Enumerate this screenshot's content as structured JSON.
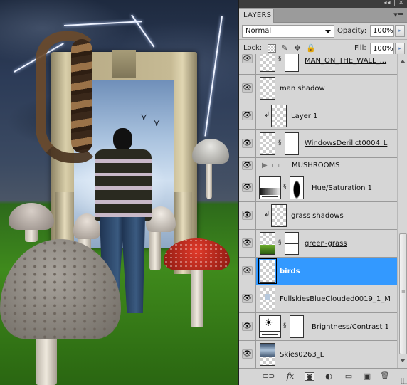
{
  "canvas": {
    "description": "Photo-manipulation artwork: man standing before stone doorway with blue sky, snake on frame, lightning, mushrooms on green grass",
    "icon": "artwork-image"
  },
  "panel": {
    "title_controls": "◂◂ | ✕",
    "tab_label": "LAYERS",
    "menu_icon": "panel-menu-icon",
    "blend_mode": "Normal",
    "opacity_label": "Opacity:",
    "opacity_value": "100%",
    "lock_label": "Lock:",
    "fill_label": "Fill:",
    "fill_value": "100%",
    "arrow_glyph": "▸"
  },
  "layers": [
    {
      "name": "MAN_ON_THE_WALL_...",
      "visible": true,
      "underlined": true,
      "type": "smart-with-mask"
    },
    {
      "name": "man shadow",
      "visible": true,
      "underlined": false,
      "type": "pixel"
    },
    {
      "name": "Layer 1",
      "visible": true,
      "underlined": false,
      "type": "clipped-pixel"
    },
    {
      "name": "WindowsDerilict0004_L",
      "visible": true,
      "underlined": true,
      "type": "smart-with-mask"
    },
    {
      "name": "MUSHROOMS",
      "visible": true,
      "underlined": false,
      "type": "group",
      "expanded": false
    },
    {
      "name": "Hue/Saturation 1",
      "visible": true,
      "underlined": false,
      "type": "adjustment-hue-saturation"
    },
    {
      "name": "grass shadows",
      "visible": true,
      "underlined": false,
      "type": "clipped-pixel"
    },
    {
      "name": "green-grass",
      "visible": true,
      "underlined": true,
      "type": "smart-with-mask"
    },
    {
      "name": "birds",
      "visible": true,
      "underlined": false,
      "type": "pixel",
      "selected": true
    },
    {
      "name": "FullskiesBlueClouded0019_1_M",
      "visible": true,
      "underlined": false,
      "type": "pixel"
    },
    {
      "name": "Brightness/Contrast 1",
      "visible": true,
      "underlined": false,
      "type": "adjustment-brightness-contrast"
    },
    {
      "name": "Skies0263_L",
      "visible": true,
      "underlined": false,
      "type": "pixel"
    }
  ],
  "footer": {
    "link": "⊂⊃",
    "fx": "fx",
    "mask": "◙",
    "adjust": "◐",
    "group": "▭",
    "new": "▣",
    "trash": "🗑"
  },
  "colors": {
    "selected": "#3399ff",
    "panel_bg": "#d6d6d6"
  }
}
